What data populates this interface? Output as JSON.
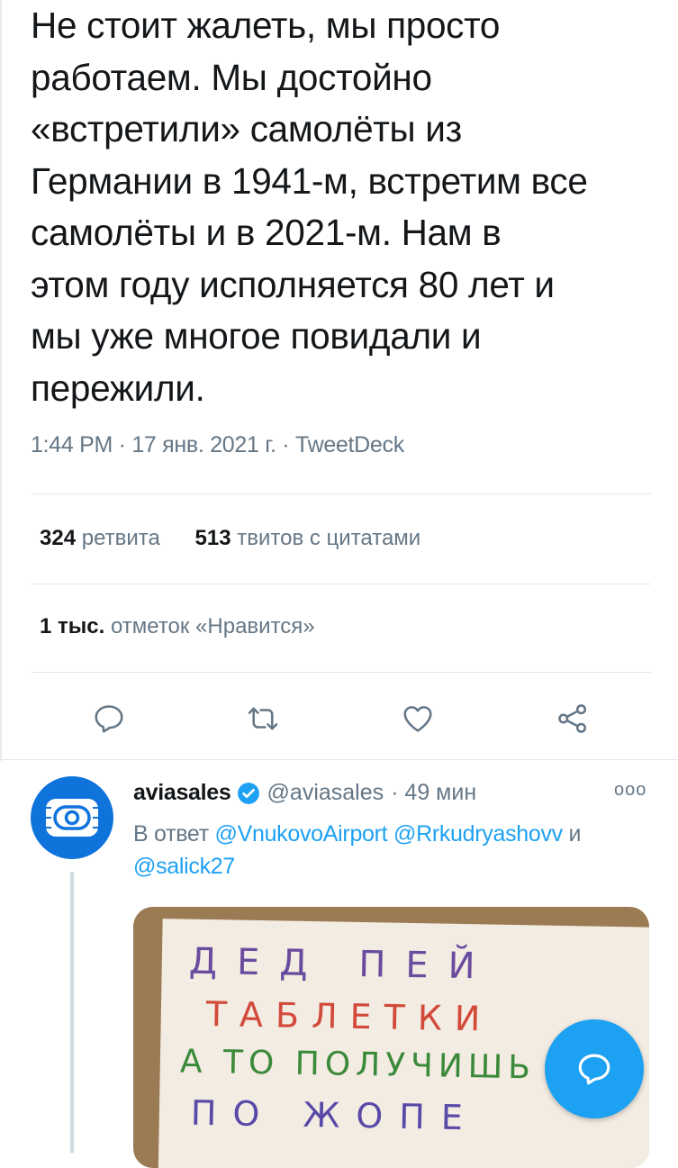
{
  "tweet": {
    "lines": [
      "Не стоит жалеть, мы просто",
      "работаем. Мы достойно",
      "«встретили» самолёты из",
      "Германии в 1941-м, встретим все",
      "самолёты и в 2021-м. Нам в",
      "этом году исполняется 80 лет и",
      "мы уже многое повидали и",
      "пережили."
    ],
    "meta": "1:44 PM · 17 янв. 2021 г. · TweetDeck"
  },
  "stats": {
    "retweets_count": "324",
    "retweets_label": "ретвита",
    "quotes_count": "513",
    "quotes_label": "твитов с цитатами",
    "likes_count": "1 тыс.",
    "likes_label": "отметок «Нравится»"
  },
  "actions": {
    "reply_icon": "reply-icon",
    "retweet_icon": "retweet-icon",
    "like_icon": "heart-icon",
    "share_icon": "share-icon"
  },
  "reply": {
    "name": "aviasales",
    "handle": "@aviasales",
    "time": "· 49 мин",
    "more": "ooo",
    "reply_prefix": "В ответ",
    "mention1": "@VnukovoAirport",
    "mention2": "@Rrkudryashovv",
    "and": "и",
    "mention3": "@salick27",
    "media": {
      "line1": "ДЕД ПЕЙ",
      "line2": "ТАБЛЕТКИ",
      "line3": "А ТО ПОЛУЧИШЬ",
      "line4": "ПО ЖОПЕ"
    }
  },
  "colors": {
    "accent": "#1da1f2",
    "muted": "#657786",
    "avatar_bg": "#0f73dc"
  }
}
